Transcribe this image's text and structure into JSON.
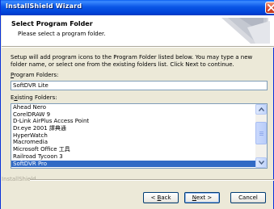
{
  "window": {
    "title": "InstallShield Wizard"
  },
  "header": {
    "title": "Select Program Folder",
    "subtitle": "Please select a program folder."
  },
  "description": "Setup will add program icons to the Program Folder listed below. You may type a new folder name, or select one from the existing folders list.  Click Next to continue.",
  "program_folders": {
    "label_accel": "P",
    "label_rest": "rogram Folders:",
    "value": "SoftDVR Lite"
  },
  "existing_folders": {
    "label_pre": "E",
    "label_accel": "x",
    "label_rest": "isting Folders:",
    "items": [
      {
        "label": "Ahead Nero",
        "selected": false
      },
      {
        "label": "CorelDRAW 9",
        "selected": false
      },
      {
        "label": "D-Link AirPlus Access Point",
        "selected": false
      },
      {
        "label": "Dr.eye 2001 譯典通",
        "selected": false
      },
      {
        "label": "HyperWatch",
        "selected": false
      },
      {
        "label": "Macromedia",
        "selected": false
      },
      {
        "label": "Microsoft Office 工具",
        "selected": false
      },
      {
        "label": "Railroad Tycoon 3",
        "selected": false
      },
      {
        "label": "SoftDVR Pro",
        "selected": true
      }
    ]
  },
  "footer": {
    "brand": "InstallShield"
  },
  "buttons": {
    "back_pre": "< ",
    "back_accel": "B",
    "back_rest": "ack",
    "next_accel": "N",
    "next_rest": "ext >",
    "cancel": "Cancel"
  },
  "colors": {
    "titlebar": "#0a56e6",
    "selection": "#316ac5",
    "dialog_bg": "#ece9d8"
  }
}
